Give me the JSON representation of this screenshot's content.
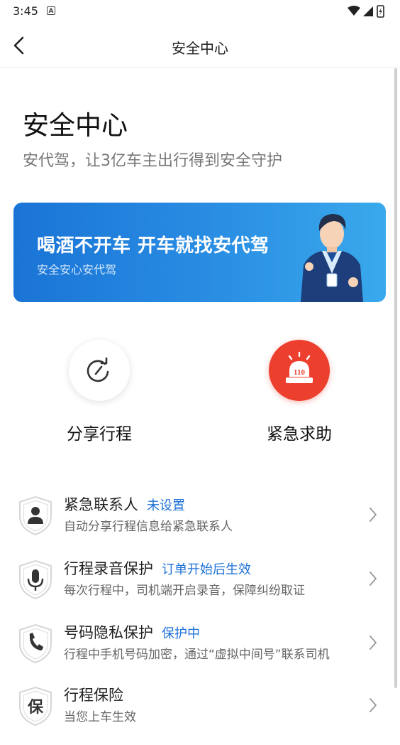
{
  "status_bar": {
    "time": "3:45",
    "notification_icon": "A"
  },
  "nav": {
    "title": "安全中心",
    "back_icon": "chevron-left-icon"
  },
  "header": {
    "title": "安全中心",
    "subtitle": "安代驾，让3亿车主出行得到安全守护"
  },
  "banner": {
    "title": "喝酒不开车 开车就找安代驾",
    "subtitle": "安全安心安代驾"
  },
  "actions": [
    {
      "label": "分享行程",
      "icon": "share-arrow-icon"
    },
    {
      "label": "紧急求助",
      "icon": "alarm-110-icon",
      "badge": "110"
    }
  ],
  "items": [
    {
      "title": "紧急联系人",
      "status": "未设置",
      "desc": "自动分享行程信息给紧急联系人",
      "icon": "person-shield-icon"
    },
    {
      "title": "行程录音保护",
      "status": "订单开始后生效",
      "desc": "每次行程中，司机端开启录音，保障纠纷取证",
      "icon": "microphone-shield-icon"
    },
    {
      "title": "号码隐私保护",
      "status": "保护中",
      "desc": "行程中手机号码加密，通过“虚拟中间号”联系司机",
      "icon": "phone-shield-icon"
    },
    {
      "title": "行程保险",
      "status": "",
      "desc": "当您上车生效",
      "icon": "insurance-shield-icon",
      "icon_text": "保"
    }
  ],
  "colors": {
    "accent": "#1f72d8",
    "danger": "#ec3f2e",
    "banner_start": "#1a74d6",
    "banner_end": "#3aa9ec"
  }
}
